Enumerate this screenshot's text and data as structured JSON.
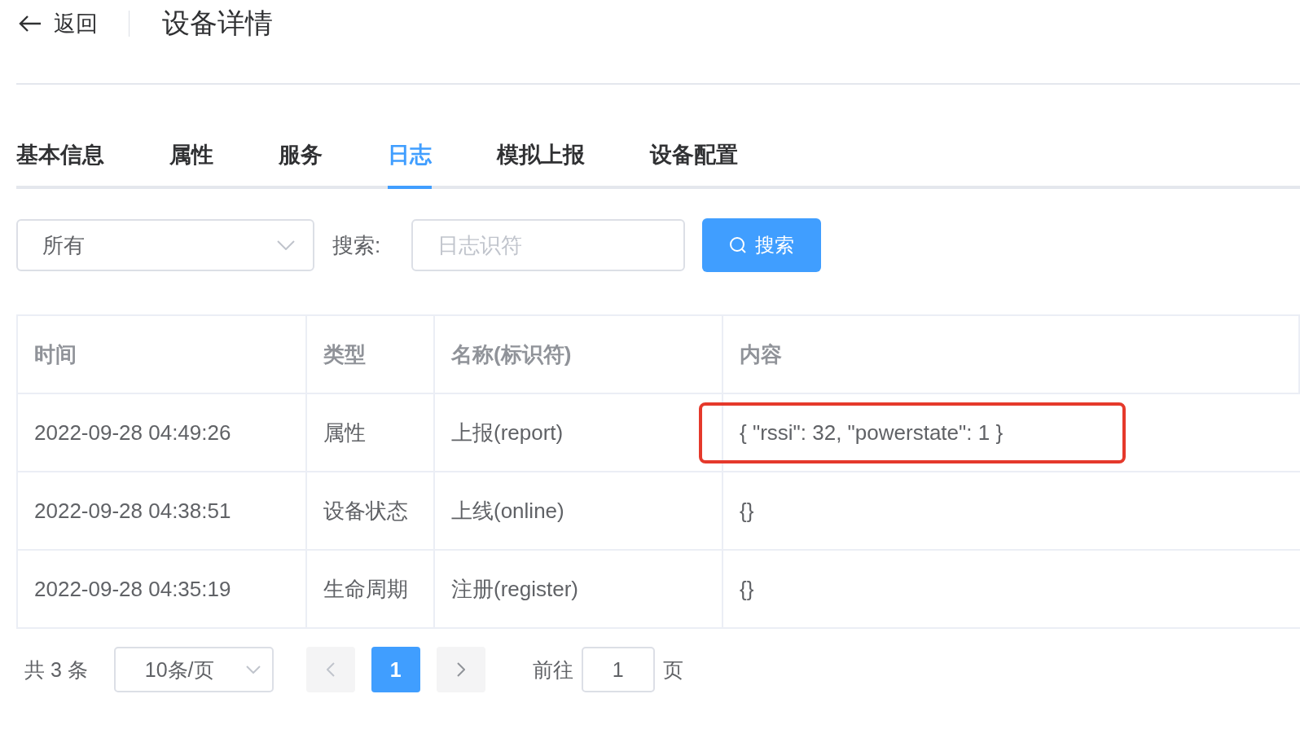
{
  "header": {
    "back_label": "返回",
    "title": "设备详情"
  },
  "tabs": [
    {
      "label": "基本信息",
      "selected": false
    },
    {
      "label": "属性",
      "selected": false
    },
    {
      "label": "服务",
      "selected": false
    },
    {
      "label": "日志",
      "selected": true
    },
    {
      "label": "模拟上报",
      "selected": false
    },
    {
      "label": "设备配置",
      "selected": false
    }
  ],
  "filter": {
    "type_select": "所有",
    "search_label": "搜索:",
    "placeholder": "日志识符",
    "search_button": "搜索"
  },
  "table": {
    "columns": [
      "时间",
      "类型",
      "名称(标识符)",
      "内容"
    ],
    "rows": [
      {
        "time": "2022-09-28 04:49:26",
        "type": "属性",
        "name": "上报(report)",
        "content": "{ \"rssi\": 32, \"powerstate\": 1 }",
        "highlighted": true
      },
      {
        "time": "2022-09-28 04:38:51",
        "type": "设备状态",
        "name": "上线(online)",
        "content": "{}",
        "highlighted": false
      },
      {
        "time": "2022-09-28 04:35:19",
        "type": "生命周期",
        "name": "注册(register)",
        "content": "{}",
        "highlighted": false
      }
    ]
  },
  "pagination": {
    "total": "共 3 条",
    "page_size": "10条/页",
    "pages": [
      {
        "label": "1",
        "selected": true
      }
    ],
    "goto_label": "前往",
    "goto_value": "1",
    "page_suffix": "页"
  }
}
